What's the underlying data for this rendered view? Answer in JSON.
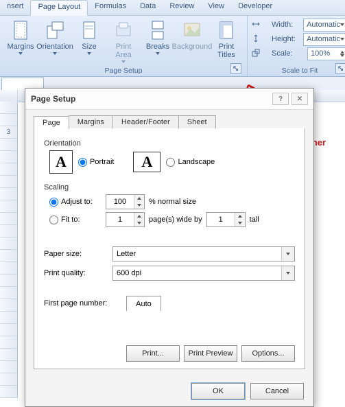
{
  "ribbon": {
    "tabs": [
      "nsert",
      "Page Layout",
      "Formulas",
      "Data",
      "Review",
      "View",
      "Developer"
    ],
    "active_tab": "Page Layout",
    "groups": {
      "page_setup": {
        "title": "Page Setup",
        "buttons": {
          "margins": "Margins",
          "orientation": "Orientation",
          "size": "Size",
          "print_area": "Print\nArea",
          "breaks": "Breaks",
          "background": "Background",
          "print_titles": "Print\nTitles"
        }
      },
      "scale_to_fit": {
        "title": "Scale to Fit",
        "width_label": "Width:",
        "width_value": "Automatic",
        "height_label": "Height:",
        "height_value": "Automatic",
        "scale_label": "Scale:",
        "scale_value": "100%"
      }
    }
  },
  "annotation": {
    "label": "Dialog Box Launcher"
  },
  "sheet": {
    "row_3_label": "3"
  },
  "dialog": {
    "title": "Page Setup",
    "tabs": [
      "Page",
      "Margins",
      "Header/Footer",
      "Sheet"
    ],
    "active_tab": "Page",
    "orientation": {
      "label": "Orientation",
      "portrait": "Portrait",
      "landscape": "Landscape",
      "selected": "portrait"
    },
    "scaling": {
      "label": "Scaling",
      "adjust_label": "Adjust to:",
      "adjust_value": "100",
      "adjust_suffix": "% normal size",
      "fit_label": "Fit to:",
      "fit_wide": "1",
      "fit_mid": "page(s) wide by",
      "fit_tall": "1",
      "fit_suffix": "tall",
      "selected": "adjust"
    },
    "paper_size": {
      "label": "Paper size:",
      "value": "Letter"
    },
    "print_quality": {
      "label": "Print quality:",
      "value": "600 dpi"
    },
    "first_page": {
      "label": "First page number:",
      "value": "Auto"
    },
    "buttons": {
      "print": "Print...",
      "preview": "Print Preview",
      "options": "Options...",
      "ok": "OK",
      "cancel": "Cancel"
    }
  }
}
